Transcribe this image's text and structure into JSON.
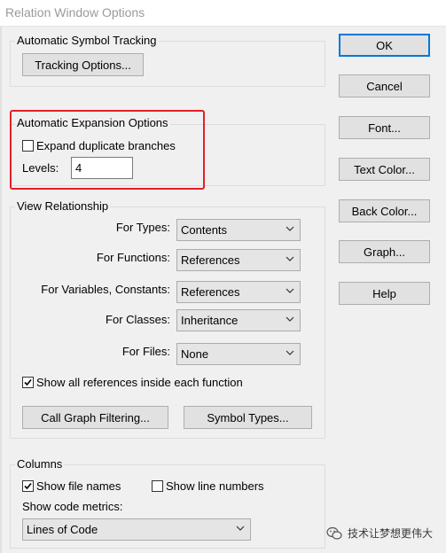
{
  "window": {
    "title": "Relation Window Options"
  },
  "symbol_tracking": {
    "group_label": "Automatic Symbol Tracking",
    "tracking_options_label": "Tracking Options..."
  },
  "expansion": {
    "group_label": "Automatic Expansion Options",
    "expand_duplicates_label": "Expand duplicate branches",
    "expand_duplicates_checked": false,
    "levels_label": "Levels:",
    "levels_value": "4"
  },
  "view_relationship": {
    "group_label": "View Relationship",
    "for_types_label": "For Types:",
    "for_types_value": "Contents",
    "for_functions_label": "For Functions:",
    "for_functions_value": "References",
    "for_variables_label": "For Variables, Constants:",
    "for_variables_value": "References",
    "for_classes_label": "For Classes:",
    "for_classes_value": "Inheritance",
    "for_files_label": "For Files:",
    "for_files_value": "None",
    "show_all_refs_label": "Show all references inside each function",
    "show_all_refs_checked": true,
    "call_graph_filtering_label": "Call Graph Filtering...",
    "symbol_types_label": "Symbol Types..."
  },
  "columns": {
    "group_label": "Columns",
    "show_file_names_label": "Show file names",
    "show_file_names_checked": true,
    "show_line_numbers_label": "Show line numbers",
    "show_line_numbers_checked": false,
    "show_code_metrics_label": "Show code metrics:",
    "code_metrics_value": "Lines of Code"
  },
  "side_buttons": {
    "ok": "OK",
    "cancel": "Cancel",
    "font": "Font...",
    "text_color": "Text Color...",
    "back_color": "Back Color...",
    "graph": "Graph...",
    "help": "Help"
  },
  "watermark": {
    "text": "技术让梦想更伟大"
  },
  "colors": {
    "highlight": "#e51f27",
    "accent": "#0078d7"
  }
}
